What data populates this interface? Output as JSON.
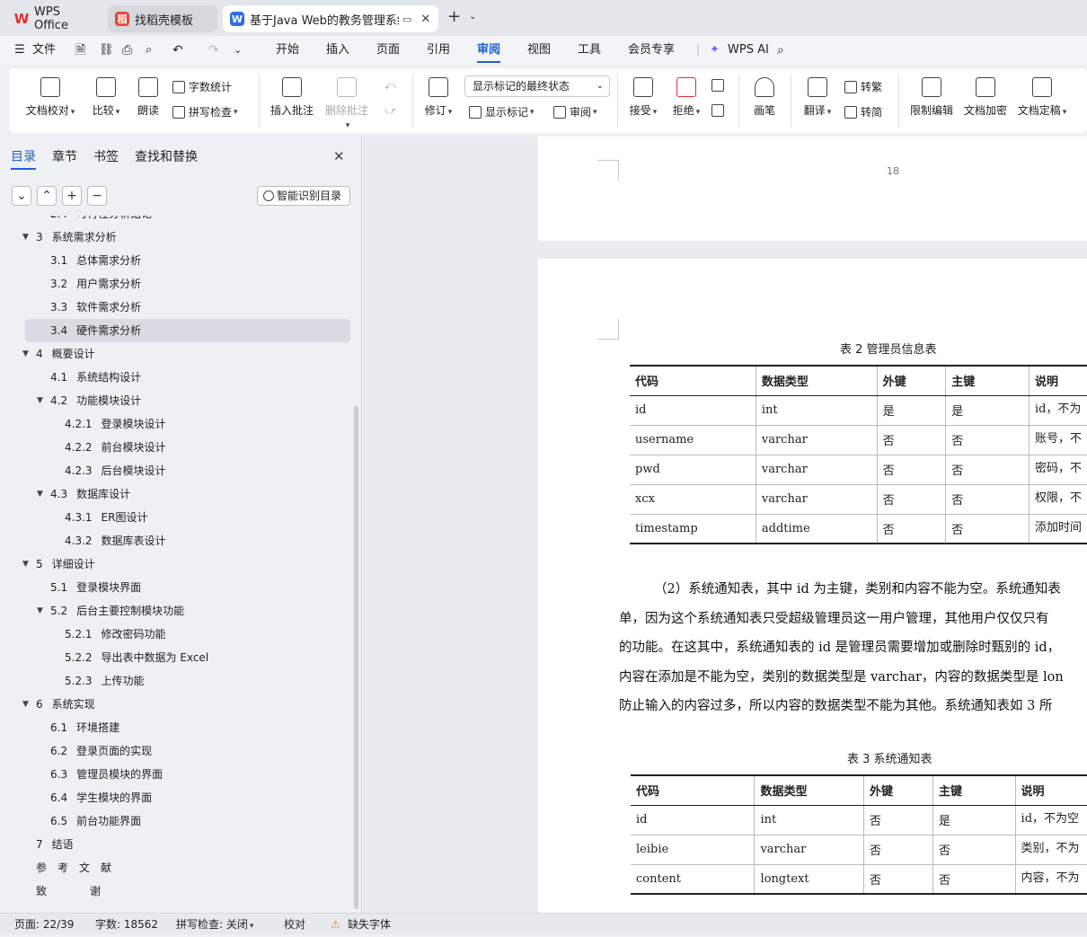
{
  "tabs": [
    {
      "label": "WPS Office",
      "icon": "wps-logo-icon",
      "color": "#e0302f"
    },
    {
      "label": "找稻壳模板",
      "icon": "docer-icon",
      "color": "#e8473b"
    },
    {
      "label": "基于Java Web的教务管理系统",
      "icon": "writer-doc-icon",
      "color": "#2b6ee8"
    }
  ],
  "menu": {
    "file": "文件",
    "items": [
      "开始",
      "插入",
      "页面",
      "引用",
      "审阅",
      "视图",
      "工具",
      "会员专享"
    ],
    "active": "审阅",
    "ai": "WPS AI"
  },
  "ribbon": {
    "proofread": "文档校对",
    "compare": "比较",
    "read_aloud": "朗读",
    "word_count": "字数统计",
    "spell_check": "拼写检查",
    "insert_comment": "插入批注",
    "delete_comment": "删除批注",
    "revise": "修订",
    "show_state": "显示标记的最终状态",
    "show_marks": "显示标记",
    "review": "审阅",
    "accept": "接受",
    "reject": "拒绝",
    "pen": "画笔",
    "translate": "翻译",
    "to_traditional": "转繁",
    "to_simplified": "转简",
    "restrict_edit": "限制编辑",
    "encrypt": "文档加密",
    "finalize": "文档定稿"
  },
  "panel": {
    "tabs": [
      "目录",
      "章节",
      "书签",
      "查找和替换"
    ],
    "smart_toc": "智能识别目录",
    "toc": [
      {
        "num": "2.4",
        "text": "可行性分析结论",
        "level": 1
      },
      {
        "num": "3",
        "text": "系统需求分析",
        "level": 0,
        "expanded": true
      },
      {
        "num": "3.1",
        "text": "总体需求分析",
        "level": 1
      },
      {
        "num": "3.2",
        "text": "用户需求分析",
        "level": 1
      },
      {
        "num": "3.3",
        "text": "软件需求分析",
        "level": 1
      },
      {
        "num": "3.4",
        "text": "硬件需求分析",
        "level": 1,
        "selected": true
      },
      {
        "num": "4",
        "text": "概要设计",
        "level": 0,
        "expanded": true
      },
      {
        "num": "4.1",
        "text": "系统结构设计",
        "level": 1
      },
      {
        "num": "4.2",
        "text": "功能模块设计",
        "level": 1,
        "expanded": true
      },
      {
        "num": "4.2.1",
        "text": "登录模块设计",
        "level": 2
      },
      {
        "num": "4.2.2",
        "text": "前台模块设计",
        "level": 2
      },
      {
        "num": "4.2.3",
        "text": "后台模块设计",
        "level": 2
      },
      {
        "num": "4.3",
        "text": "数据库设计",
        "level": 1,
        "expanded": true
      },
      {
        "num": "4.3.1",
        "text": "ER图设计",
        "level": 2
      },
      {
        "num": "4.3.2",
        "text": "数据库表设计",
        "level": 2
      },
      {
        "num": "5",
        "text": "详细设计",
        "level": 0,
        "expanded": true
      },
      {
        "num": "5.1",
        "text": "登录模块界面",
        "level": 1
      },
      {
        "num": "5.2",
        "text": "后台主要控制模块功能",
        "level": 1,
        "expanded": true
      },
      {
        "num": "5.2.1",
        "text": "修改密码功能",
        "level": 2
      },
      {
        "num": "5.2.2",
        "text": "导出表中数据为 Excel",
        "level": 2
      },
      {
        "num": "5.2.3",
        "text": "上传功能",
        "level": 2
      },
      {
        "num": "6",
        "text": "系统实现",
        "level": 0,
        "expanded": true
      },
      {
        "num": "6.1",
        "text": "环境搭建",
        "level": 1
      },
      {
        "num": "6.2",
        "text": "登录页面的实现",
        "level": 1
      },
      {
        "num": "6.3",
        "text": "管理员模块的界面",
        "level": 1
      },
      {
        "num": "6.4",
        "text": "学生模块的界面",
        "level": 1
      },
      {
        "num": "6.5",
        "text": "前台功能界面",
        "level": 1
      },
      {
        "num": "7",
        "text": "结语",
        "level": 0
      },
      {
        "num": "",
        "text": "参　考　文　献",
        "level": 0
      },
      {
        "num": "",
        "text": "致　　　　谢",
        "level": 0
      }
    ]
  },
  "doc": {
    "page_number": "18",
    "table2": {
      "caption": "表 2  管理员信息表",
      "headers": [
        "代码",
        "数据类型",
        "外键",
        "主键",
        "说明"
      ],
      "rows": [
        [
          "id",
          "int",
          "是",
          "是",
          "id，不为"
        ],
        [
          "username",
          "varchar",
          "否",
          "否",
          "账号，不"
        ],
        [
          "pwd",
          "varchar",
          "否",
          "否",
          "密码，不"
        ],
        [
          "xcx",
          "varchar",
          "否",
          "否",
          "权限，不"
        ],
        [
          "timestamp",
          "addtime",
          "否",
          "否",
          "添加时间"
        ]
      ]
    },
    "paragraph": [
      "（2）系统通知表，其中 id 为主键，类别和内容不能为空。系统通知表",
      "单，因为这个系统通知表只受超级管理员这一用户管理，其他用户仅仅只有",
      "的功能。在这其中，系统通知表的 id 是管理员需要增加或删除时甄别的 id，",
      "内容在添加是不能为空，类别的数据类型是 varchar，内容的数据类型是 lon",
      "防止输入的内容过多，所以内容的数据类型不能为其他。系统通知表如 3 所"
    ],
    "table3": {
      "caption": "表 3  系统通知表",
      "headers": [
        "代码",
        "数据类型",
        "外键",
        "主键",
        "说明"
      ],
      "rows": [
        [
          "id",
          "int",
          "否",
          "是",
          "id，不为空"
        ],
        [
          "leibie",
          "varchar",
          "否",
          "否",
          "类别，不为"
        ],
        [
          "content",
          "longtext",
          "否",
          "否",
          "内容，不为"
        ]
      ]
    }
  },
  "status": {
    "page": "页面: 22/39",
    "words": "字数: 18562",
    "spell": "拼写检查: 关闭",
    "proof": "校对",
    "missing_font": "缺失字体"
  }
}
